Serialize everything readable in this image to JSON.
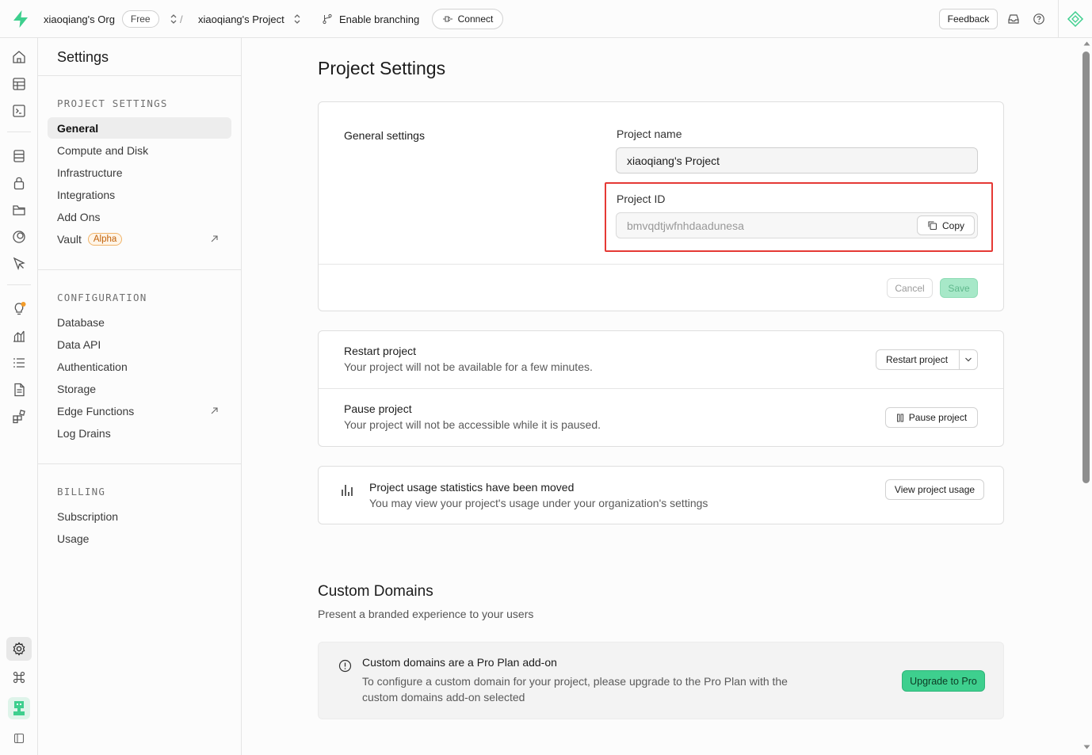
{
  "topbar": {
    "org_name": "xiaoqiang's Org",
    "plan_badge": "Free",
    "separator": "/",
    "project_name": "xiaoqiang's Project",
    "branching_label": "Enable branching",
    "connect_label": "Connect",
    "feedback_label": "Feedback"
  },
  "sidebar": {
    "title": "Settings",
    "sections": [
      {
        "heading": "PROJECT SETTINGS",
        "items": [
          "General",
          "Compute and Disk",
          "Infrastructure",
          "Integrations",
          "Add Ons",
          "Vault"
        ]
      },
      {
        "heading": "CONFIGURATION",
        "items": [
          "Database",
          "Data API",
          "Authentication",
          "Storage",
          "Edge Functions",
          "Log Drains"
        ]
      },
      {
        "heading": "BILLING",
        "items": [
          "Subscription",
          "Usage"
        ]
      }
    ],
    "vault_badge": "Alpha"
  },
  "main": {
    "page_title": "Project Settings",
    "general": {
      "section_label": "General settings",
      "project_name_label": "Project name",
      "project_name_value": "xiaoqiang's Project",
      "project_id_label": "Project ID",
      "project_id_value": "bmvqdtjwfnhdaadunesa",
      "copy_label": "Copy",
      "cancel_label": "Cancel",
      "save_label": "Save"
    },
    "restart": {
      "title": "Restart project",
      "desc": "Your project will not be available for a few minutes.",
      "button": "Restart project"
    },
    "pause": {
      "title": "Pause project",
      "desc": "Your project will not be accessible while it is paused.",
      "button": "Pause project"
    },
    "usage": {
      "title": "Project usage statistics have been moved",
      "desc": "You may view your project's usage under your organization's settings",
      "button": "View project usage"
    },
    "custom_domains": {
      "title": "Custom Domains",
      "subtitle": "Present a branded experience to your users",
      "notice_title": "Custom domains are a Pro Plan add-on",
      "notice_desc_1": "To configure a custom domain for your project, please upgrade to the Pro Plan with the",
      "notice_desc_2": "custom domains add-on selected",
      "upgrade_button": "Upgrade to Pro"
    }
  },
  "colors": {
    "brand_green": "#3ecf8e",
    "highlight_red": "#e53935",
    "alpha_orange": "#c2620a"
  }
}
